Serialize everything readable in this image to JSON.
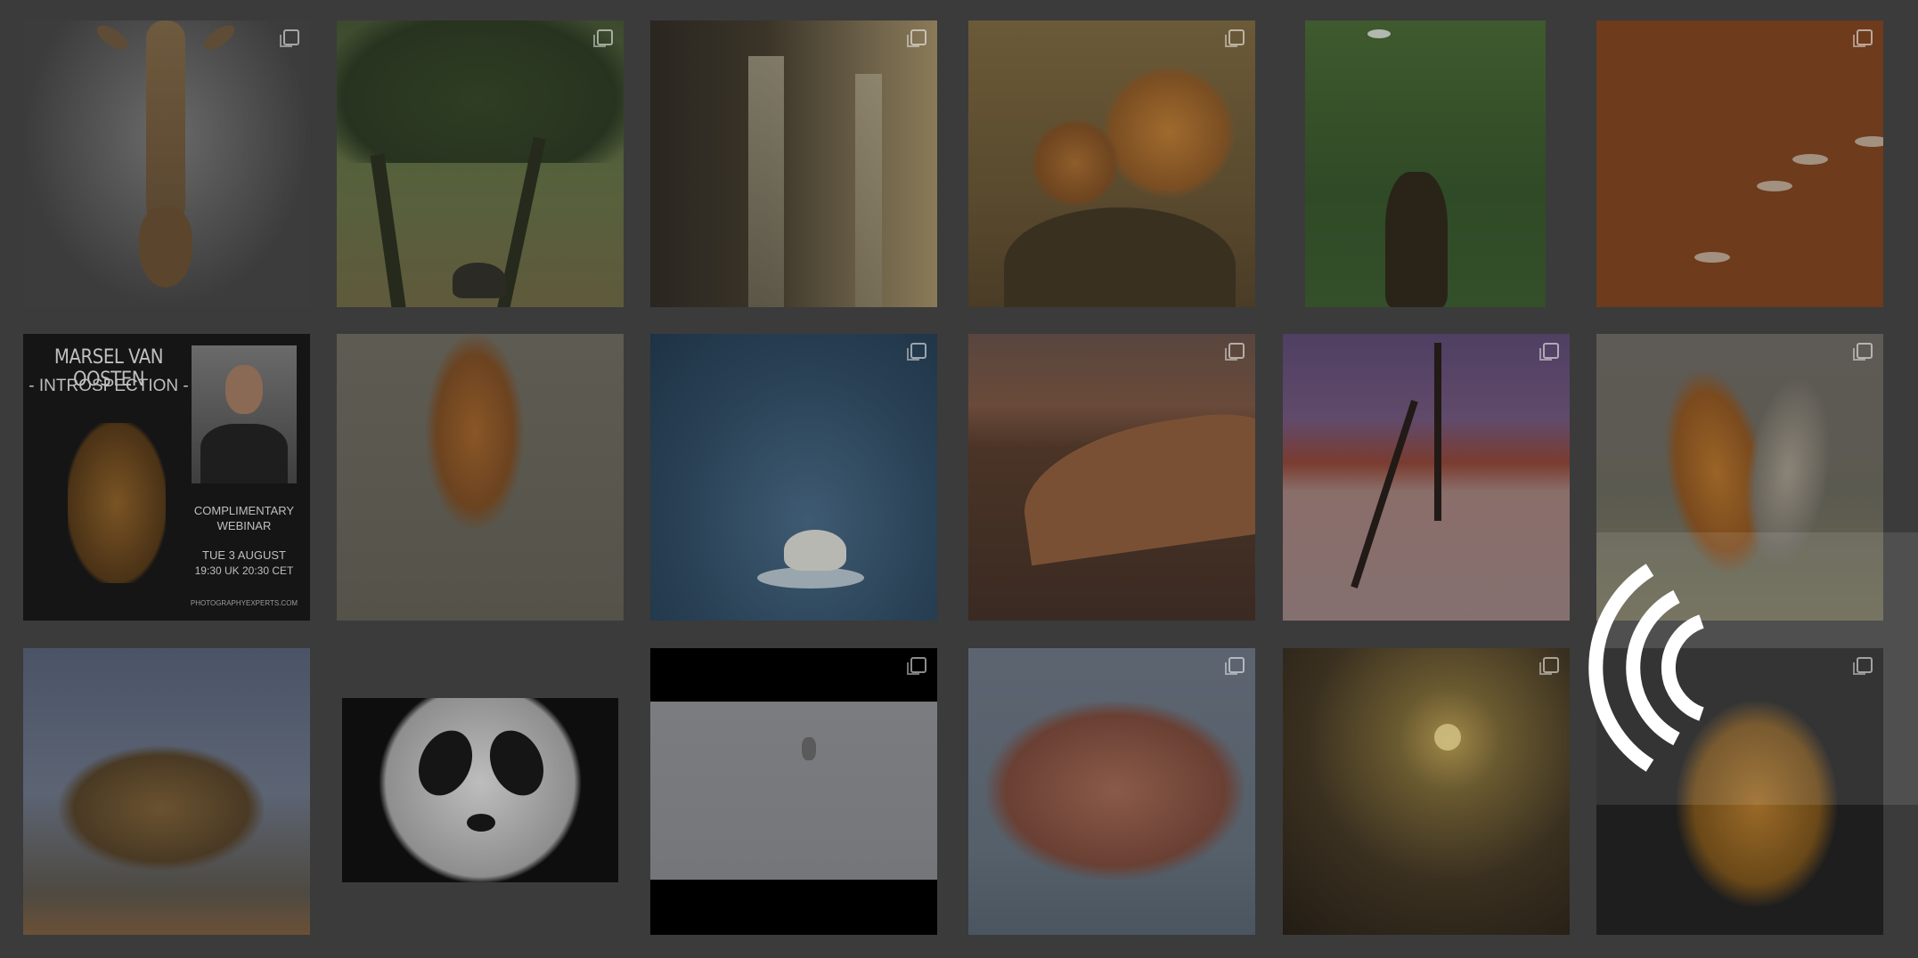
{
  "gallery": {
    "webinar": {
      "name": "MARSEL VAN OOSTEN",
      "subtitle": "- INTROSPECTION -",
      "complimentary": "COMPLIMENTARY",
      "webinar_word": "WEBINAR",
      "date": "TUE 3 AUGUST",
      "time": "19:30 UK  20:30 CET",
      "site": "PHOTOGRAPHYEXPERTS.COM"
    }
  },
  "overlay": {
    "state": "loading",
    "icon": "wifi-signal-icon"
  }
}
